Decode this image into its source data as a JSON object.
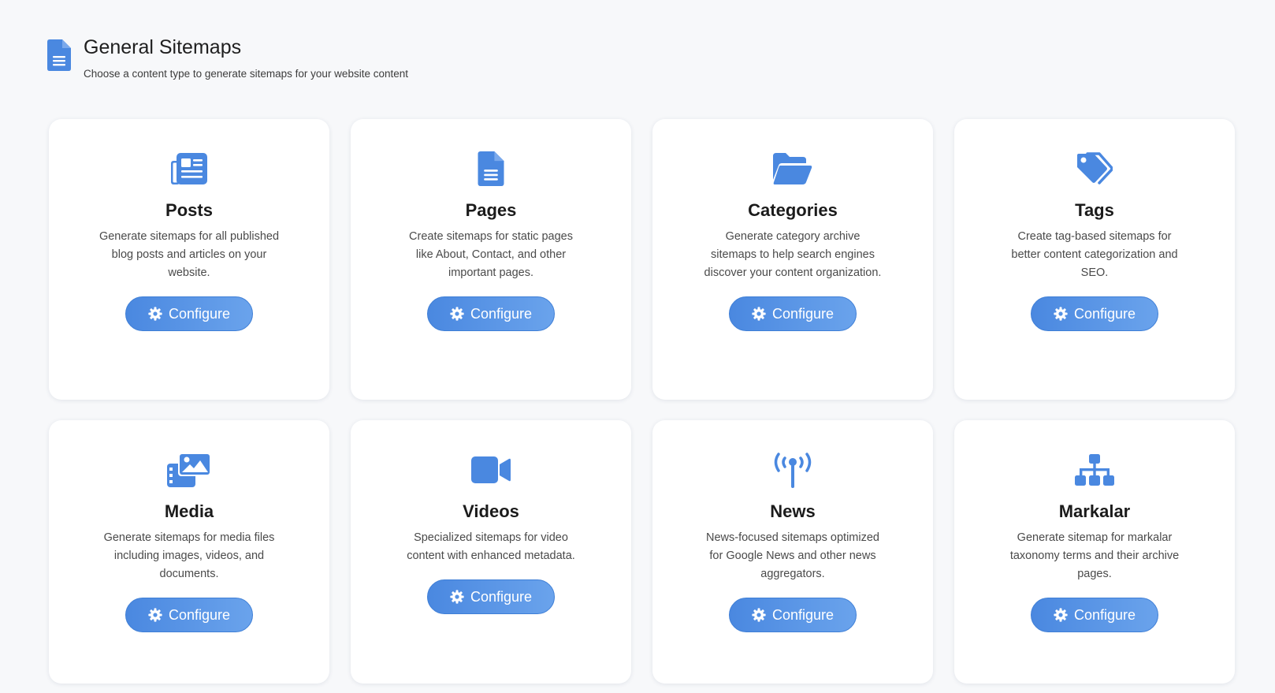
{
  "header": {
    "title": "General Sitemaps",
    "subtitle": "Choose a content type to generate sitemaps for your website content",
    "icon": "file-alt-icon"
  },
  "colors": {
    "accent": "#4a88e0",
    "accent_light": "#6aa3ec",
    "background": "#f7f8fa",
    "card": "#ffffff"
  },
  "cards": [
    {
      "icon": "newspaper-icon",
      "title": "Posts",
      "description": "Generate sitemaps for all published blog posts and articles on your website.",
      "button": "Configure"
    },
    {
      "icon": "file-alt-icon",
      "title": "Pages",
      "description": "Create sitemaps for static pages like About, Contact, and other important pages.",
      "button": "Configure"
    },
    {
      "icon": "folder-open-icon",
      "title": "Categories",
      "description": "Generate category archive sitemaps to help search engines discover your content organization.",
      "button": "Configure"
    },
    {
      "icon": "tags-icon",
      "title": "Tags",
      "description": "Create tag-based sitemaps for better content categorization and SEO.",
      "button": "Configure"
    },
    {
      "icon": "photo-video-icon",
      "title": "Media",
      "description": "Generate sitemaps for media files including images, videos, and documents.",
      "button": "Configure"
    },
    {
      "icon": "video-icon",
      "title": "Videos",
      "description": "Specialized sitemaps for video content with enhanced metadata.",
      "button": "Configure"
    },
    {
      "icon": "broadcast-tower-icon",
      "title": "News",
      "description": "News-focused sitemaps optimized for Google News and other news aggregators.",
      "button": "Configure"
    },
    {
      "icon": "sitemap-icon",
      "title": "Markalar",
      "description": "Generate sitemap for markalar taxonomy terms and their archive pages.",
      "button": "Configure"
    }
  ]
}
